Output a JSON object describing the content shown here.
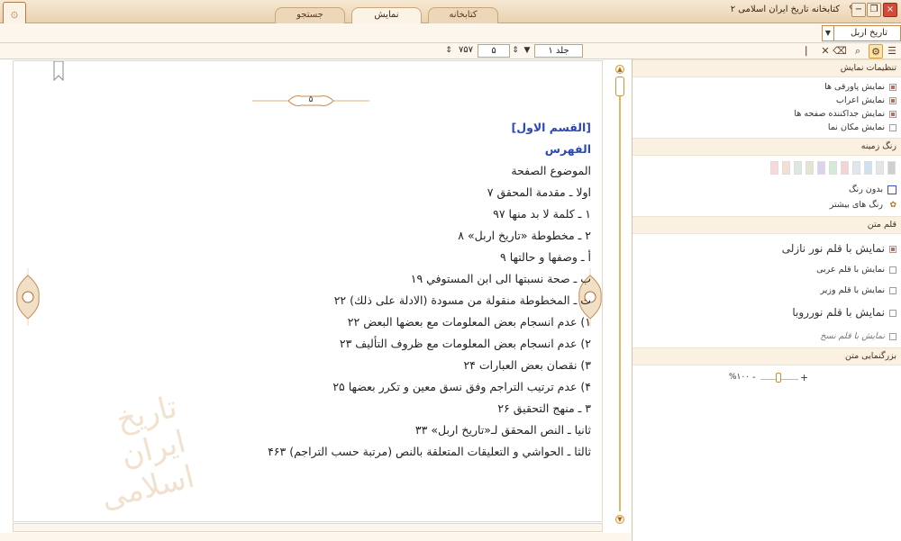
{
  "window": {
    "title": "کتابخانه تاریخ ایران اسلامی ۲",
    "help": "؟",
    "tabs": [
      "کتابخانه",
      "نمایش",
      "جستجو"
    ],
    "active_tab": "نمایش",
    "buttons": [
      "minimize",
      "maximize",
      "restore",
      "close"
    ]
  },
  "book_selector": {
    "value": "تاریخ اربل"
  },
  "navigation": {
    "volume": "جلد ۱",
    "page": "۵",
    "total_pages": "۷۵۷"
  },
  "reader": {
    "page_number": "۵",
    "lines": [
      {
        "text": "[القسم الاول]",
        "style": "blue"
      },
      {
        "text": "الفهرس",
        "style": "blue"
      },
      {
        "text": "الموضوع الصفحة",
        "style": "normal"
      },
      {
        "text": "اولا ـ مقدمة المحقق ۷",
        "style": "normal"
      },
      {
        "text": "۱ ـ كلمة لا بد منها ۹۷",
        "style": "normal"
      },
      {
        "text": "۲ ـ مخطوطة «تاريخ اربل» ۸",
        "style": "normal"
      },
      {
        "text": "أ ـ وصفها و حالتها ۹",
        "style": "normal"
      },
      {
        "text": "ب ـ صحة نسبتها الى ابن المستوفي ۱۹",
        "style": "normal"
      },
      {
        "text": "ت ـ المخطوطة منقولة من مسودة (الادلة على ذلك) ۲۲",
        "style": "normal"
      },
      {
        "text": "۱) عدم انسجام بعض المعلومات مع بعضها البعض ۲۲",
        "style": "normal"
      },
      {
        "text": "۲) عدم انسجام بعض المعلومات مع ظروف التأليف ۲۳",
        "style": "normal"
      },
      {
        "text": "۳) نقصان بعض العبارات ۲۴",
        "style": "normal"
      },
      {
        "text": "۴) عدم ترتيب التراجم وفق نسق معين و تكرر بعضها ۲۵",
        "style": "normal"
      },
      {
        "text": "۳ ـ منهج التحقيق ۲۶",
        "style": "normal"
      },
      {
        "text": "ثانيا ـ النص المحقق لـ«تاريخ اربل» ۳۳",
        "style": "normal"
      },
      {
        "text": "ثالثا ـ الحواشي و التعليقات المتعلقة بالنص (مرتبة حسب التراجم) ۴۶۳",
        "style": "normal"
      }
    ],
    "watermark": "تاریخ ایران اسلامی"
  },
  "panel": {
    "display_settings": {
      "title": "تنظیمات نمایش",
      "options": [
        {
          "label": "نمایش پاورقی ها",
          "checked": true
        },
        {
          "label": "نمایش اعراب",
          "checked": true
        },
        {
          "label": "نمایش جداکننده صفحه ها",
          "checked": true
        },
        {
          "label": "نمایش مکان نما",
          "checked": false
        }
      ]
    },
    "background_color": {
      "title": "رنگ زمینه",
      "swatches": [
        "#cfcfcf",
        "#e6e6e6",
        "#cfe0ef",
        "#dfe6ee",
        "#f3d3d3",
        "#d3ead8",
        "#dcd3ea",
        "#e6e6d0",
        "#dde9e0",
        "#f3dfd3",
        "#f7d9d9"
      ],
      "no_color": "بدون رنگ",
      "more_colors": "رنگ های بیشتر"
    },
    "font": {
      "title": "قلم متن",
      "options": [
        {
          "label": "نمایش با قلم نور نازلی",
          "checked": true,
          "size": "big"
        },
        {
          "label": "نمایش با قلم عربی",
          "checked": false,
          "size": "normal"
        },
        {
          "label": "نمایش با قلم وزیر",
          "checked": false,
          "size": "normal"
        },
        {
          "label": "نمایش با قلم نورروبا",
          "checked": false,
          "size": "big"
        },
        {
          "label": "نمایش با قلم نسخ",
          "checked": false,
          "size": "faded"
        }
      ]
    },
    "zoom": {
      "title": "بزرگنمایی متن",
      "value": "%۱۰۰",
      "level": 1.0,
      "minus": "-",
      "plus": "+"
    }
  },
  "colors": {
    "accent": "#c98a4c",
    "title_bar": "#ead2b0",
    "link_blue": "#2a48b8"
  }
}
